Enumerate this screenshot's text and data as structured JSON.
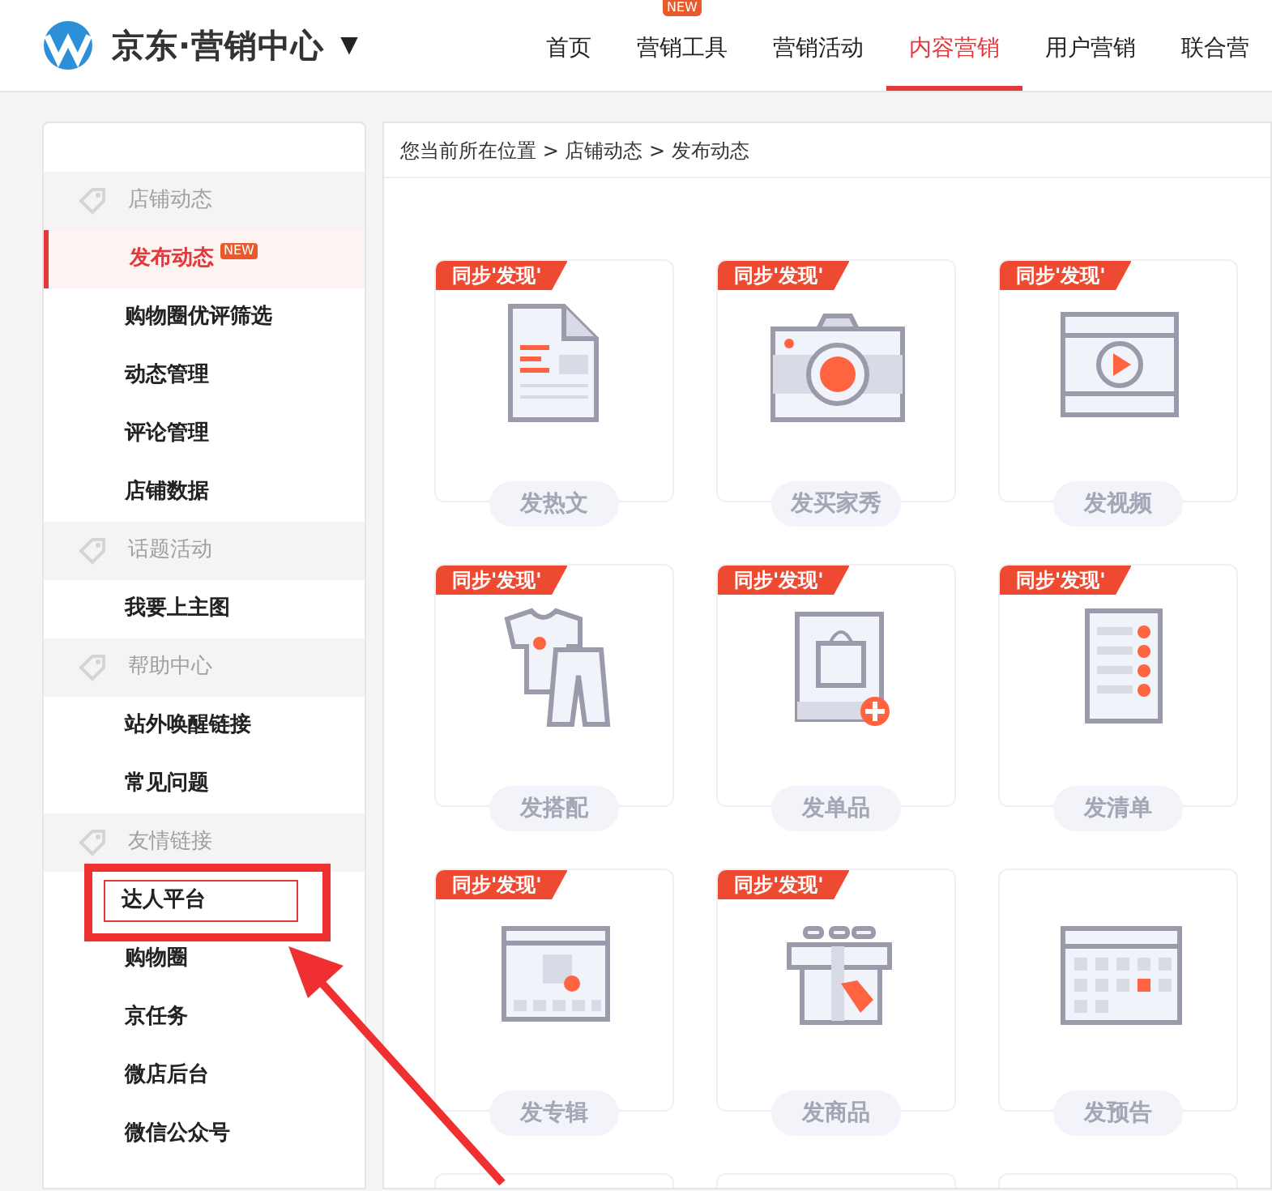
{
  "header": {
    "brand": "京东·营销中心",
    "caret": "▼",
    "nav": [
      {
        "label": "首页",
        "selected": false
      },
      {
        "label": "营销工具",
        "selected": false,
        "badge": "NEW"
      },
      {
        "label": "营销活动",
        "selected": false
      },
      {
        "label": "内容营销",
        "selected": true
      },
      {
        "label": "用户营销",
        "selected": false
      },
      {
        "label": "联合营",
        "selected": false
      }
    ]
  },
  "sidebar": {
    "groups": [
      {
        "title": "店铺动态",
        "items": [
          {
            "label": "发布动态",
            "selected": true,
            "badge": "NEW"
          },
          {
            "label": "购物圈优评筛选",
            "selected": false
          },
          {
            "label": "动态管理",
            "selected": false
          },
          {
            "label": "评论管理",
            "selected": false
          },
          {
            "label": "店铺数据",
            "selected": false
          }
        ]
      },
      {
        "title": "话题活动",
        "items": [
          {
            "label": "我要上主图",
            "selected": false
          }
        ]
      },
      {
        "title": "帮助中心",
        "items": [
          {
            "label": "站外唤醒链接",
            "selected": false
          },
          {
            "label": "常见问题",
            "selected": false
          }
        ]
      },
      {
        "title": "友情链接",
        "items": [
          {
            "label": "达人平台",
            "selected": false,
            "highlighted": true
          },
          {
            "label": "购物圈",
            "selected": false
          },
          {
            "label": "京任务",
            "selected": false
          },
          {
            "label": "微店后台",
            "selected": false
          },
          {
            "label": "微信公众号",
            "selected": false
          }
        ]
      }
    ]
  },
  "breadcrumb": "您当前所在位置 > 店铺动态 > 发布动态",
  "cards": [
    {
      "badge": "同步'发现'",
      "label": "发热文"
    },
    {
      "badge": "同步'发现'",
      "label": "发买家秀"
    },
    {
      "badge": "同步'发现'",
      "label": "发视频"
    },
    {
      "badge": "同步'发现'",
      "label": "发搭配"
    },
    {
      "badge": "同步'发现'",
      "label": "发单品"
    },
    {
      "badge": "同步'发现'",
      "label": "发清单"
    },
    {
      "badge": "同步'发现'",
      "label": "发专辑"
    },
    {
      "badge": "同步'发现'",
      "label": "发商品"
    },
    {
      "label": "发预告"
    }
  ]
}
